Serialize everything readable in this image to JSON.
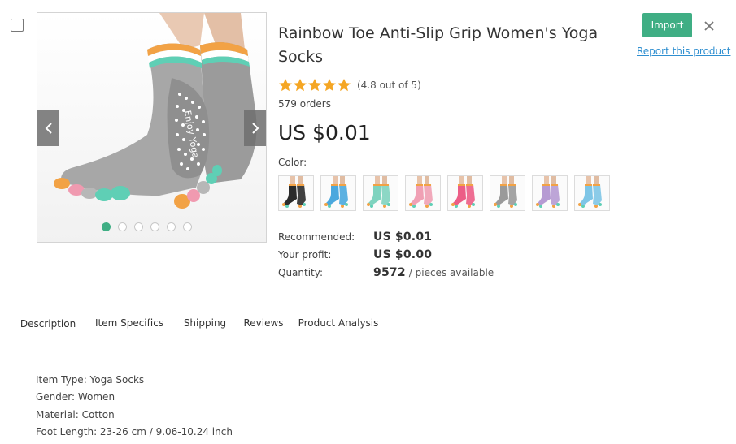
{
  "product": {
    "title": "Rainbow Toe Anti-Slip Grip Women's Yoga Socks",
    "rating_text": "(4.8 out of 5)",
    "rating_value": 4.8,
    "rating_max": 5,
    "orders": "579 orders",
    "price": "US $0.01",
    "color_label": "Color:",
    "colors": [
      {
        "name": "black",
        "hex": "#2b2b2b"
      },
      {
        "name": "blue",
        "hex": "#4aa8de"
      },
      {
        "name": "mint",
        "hex": "#7fd3bf"
      },
      {
        "name": "pink",
        "hex": "#f0a0b4"
      },
      {
        "name": "rose",
        "hex": "#ec5d86"
      },
      {
        "name": "gray",
        "hex": "#9a9a9a"
      },
      {
        "name": "purple",
        "hex": "#b69bd3"
      },
      {
        "name": "light-blue",
        "hex": "#7ec5e6"
      }
    ],
    "image_text": "Enjoy Yoga",
    "gallery_count": 6,
    "gallery_active": 0
  },
  "pricing": {
    "recommended_label": "Recommended:",
    "recommended_value": "US $0.01",
    "profit_label": "Your profit:",
    "profit_value": "US $0.00",
    "quantity_label": "Quantity:",
    "quantity_value": "9572",
    "quantity_suffix": "/ pieces available"
  },
  "actions": {
    "import_label": "Import",
    "report_label": "Report this product"
  },
  "tabs": [
    {
      "label": "Description",
      "active": true
    },
    {
      "label": "Item Specifics",
      "active": false
    },
    {
      "label": "Shipping",
      "active": false
    },
    {
      "label": "Reviews",
      "active": false
    },
    {
      "label": "Product Analysis",
      "active": false
    }
  ],
  "description": [
    "Item Type: Yoga Socks",
    "Gender: Women",
    "Material: Cotton",
    "Foot Length: 23-26 cm / 9.06-10.24 inch"
  ],
  "theme": {
    "accent": "#3fae84",
    "link": "#2f8fd0",
    "star": "#f5a623"
  }
}
